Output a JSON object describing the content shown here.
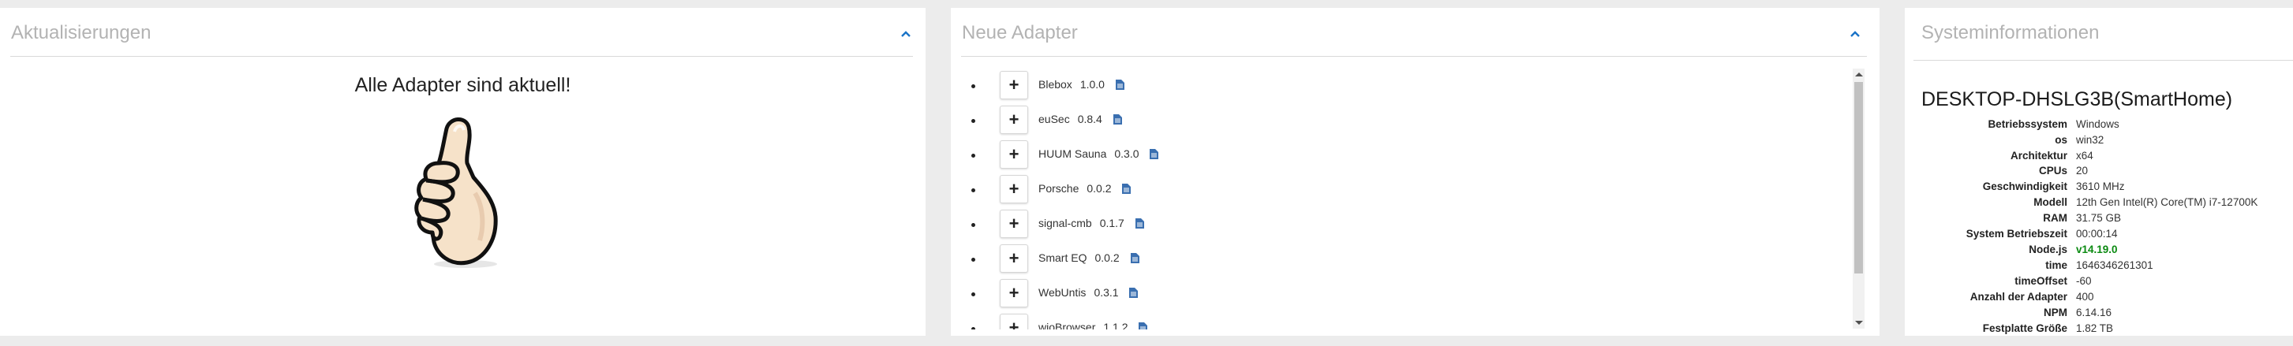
{
  "updates": {
    "title": "Aktualisierungen",
    "message": "Alle Adapter sind aktuell!"
  },
  "new_adapters": {
    "title": "Neue Adapter",
    "items": [
      {
        "name": "Blebox",
        "version": "1.0.0"
      },
      {
        "name": "euSec",
        "version": "0.8.4"
      },
      {
        "name": "HUUM Sauna",
        "version": "0.3.0"
      },
      {
        "name": "Porsche",
        "version": "0.0.2"
      },
      {
        "name": "signal-cmb",
        "version": "0.1.7"
      },
      {
        "name": "Smart EQ",
        "version": "0.0.2"
      },
      {
        "name": "WebUntis",
        "version": "0.3.1"
      },
      {
        "name": "wioBrowser",
        "version": "1.1.2"
      }
    ],
    "add_label": "+"
  },
  "system_info": {
    "title": "Systeminformationen",
    "hostname": "DESKTOP-DHSLG3B(SmartHome)",
    "rows": [
      {
        "key": "Betriebssystem",
        "value": "Windows"
      },
      {
        "key": "os",
        "value": "win32"
      },
      {
        "key": "Architektur",
        "value": "x64"
      },
      {
        "key": "CPUs",
        "value": "20"
      },
      {
        "key": "Geschwindigkeit",
        "value": "3610 MHz"
      },
      {
        "key": "Modell",
        "value": "12th Gen Intel(R) Core(TM) i7-12700K"
      },
      {
        "key": "RAM",
        "value": "31.75 GB"
      },
      {
        "key": "System Betriebszeit",
        "value": "00:00:14"
      },
      {
        "key": "Node.js",
        "value": "v14.19.0"
      },
      {
        "key": "time",
        "value": "1646346261301"
      },
      {
        "key": "timeOffset",
        "value": "-60"
      },
      {
        "key": "Anzahl der Adapter",
        "value": "400"
      },
      {
        "key": "NPM",
        "value": "6.14.16"
      },
      {
        "key": "Festplatte Größe",
        "value": "1.82 TB"
      }
    ]
  },
  "colors": {
    "accent": "#1a73c7",
    "doc_icon": "#3a6fb0",
    "node_version": "#0b8a11",
    "title_gray": "#b3b3b3"
  }
}
